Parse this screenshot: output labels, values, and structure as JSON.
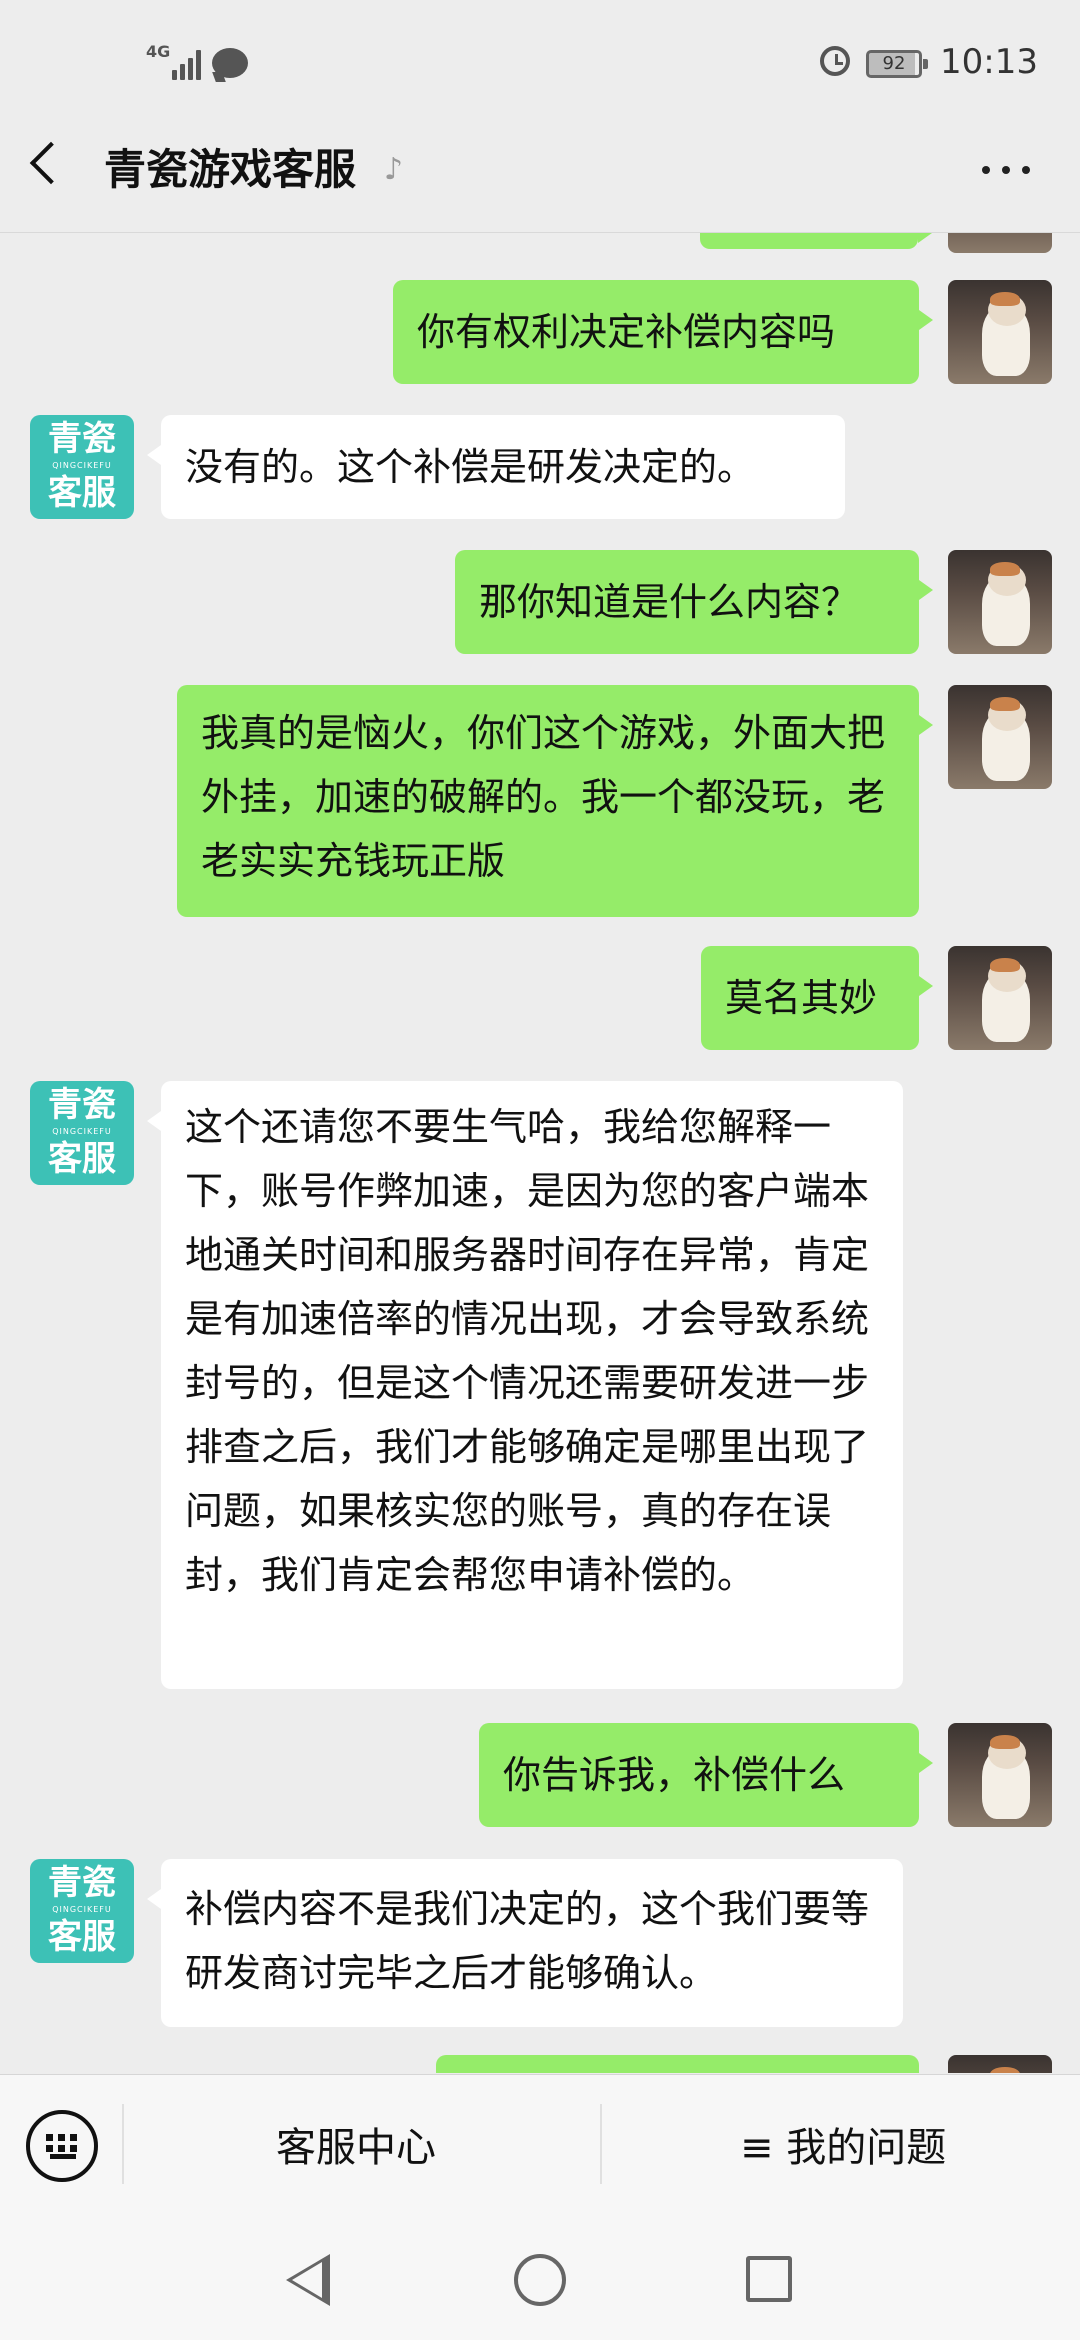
{
  "status_bar": {
    "network": "4G",
    "battery": "92",
    "time": "10:13"
  },
  "header": {
    "title": "青瓷游戏客服"
  },
  "cs_avatar": {
    "line1": "青瓷",
    "sub": "QINGCIKEFU",
    "line2": "客服"
  },
  "messages": [
    {
      "side": "me",
      "text": "你有权利决定补偿内容吗"
    },
    {
      "side": "them",
      "text": "没有的。这个补偿是研发决定的。"
    },
    {
      "side": "me",
      "text": "那你知道是什么内容？"
    },
    {
      "side": "me",
      "text": "我真的是恼火，你们这个游戏，外面大把外挂，加速的破解的。我一个都没玩，老老实实充钱玩正版"
    },
    {
      "side": "me",
      "text": "莫名其妙"
    },
    {
      "side": "them",
      "text": "这个还请您不要生气哈，我给您解释一下，账号作弊加速，是因为您的客户端本地通关时间和服务器时间存在异常，肯定是有加速倍率的情况出现，才会导致系统封号的，但是这个情况还需要研发进一步排查之后，我们才能够确定是哪里出现了问题，如果核实您的账号，真的存在误封，我们肯定会帮您申请补偿的。"
    },
    {
      "side": "me",
      "text": "你告诉我，补偿什么"
    },
    {
      "side": "them",
      "text": "补偿内容不是我们决定的，这个我们要等研发商讨完毕之后才能够确认。"
    }
  ],
  "bottom_bar": {
    "service_center": "客服中心",
    "my_questions": "≡ 我的问题"
  },
  "colors": {
    "my_bubble": "#95ec69",
    "their_bubble": "#ffffff",
    "cs_avatar": "#3dc1b6",
    "background": "#ededed"
  }
}
